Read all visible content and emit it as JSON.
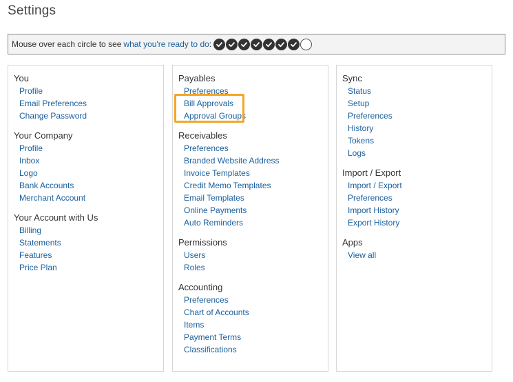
{
  "page": {
    "title": "Settings"
  },
  "progress": {
    "text_prefix": "Mouse over each circle to see",
    "link_text": "what you're ready to do",
    "text_suffix": ":",
    "steps": [
      {
        "done": true
      },
      {
        "done": true
      },
      {
        "done": true
      },
      {
        "done": true
      },
      {
        "done": true
      },
      {
        "done": true
      },
      {
        "done": true
      },
      {
        "done": false
      }
    ]
  },
  "columns": [
    {
      "sections": [
        {
          "heading": "You",
          "links": [
            "Profile",
            "Email Preferences",
            "Change Password"
          ]
        },
        {
          "heading": "Your Company",
          "links": [
            "Profile",
            "Inbox",
            "Logo",
            "Bank Accounts",
            "Merchant Account"
          ]
        },
        {
          "heading": "Your Account with Us",
          "links": [
            "Billing",
            "Statements",
            "Features",
            "Price Plan"
          ]
        }
      ]
    },
    {
      "sections": [
        {
          "heading": "Payables",
          "links": [
            "Preferences",
            "Bill Approvals",
            "Approval Groups"
          ]
        },
        {
          "heading": "Receivables",
          "links": [
            "Preferences",
            "Branded Website Address",
            "Invoice Templates",
            "Credit Memo Templates",
            "Email Templates",
            "Online Payments",
            "Auto Reminders"
          ]
        },
        {
          "heading": "Permissions",
          "links": [
            "Users",
            "Roles"
          ]
        },
        {
          "heading": "Accounting",
          "links": [
            "Preferences",
            "Chart of Accounts",
            "Items",
            "Payment Terms",
            "Classifications"
          ]
        }
      ]
    },
    {
      "sections": [
        {
          "heading": "Sync",
          "links": [
            "Status",
            "Setup",
            "Preferences",
            "History",
            "Tokens",
            "Logs"
          ]
        },
        {
          "heading": "Import / Export",
          "links": [
            "Import / Export",
            "Preferences",
            "Import History",
            "Export History"
          ]
        },
        {
          "heading": "Apps",
          "links": [
            "View all"
          ]
        }
      ]
    }
  ],
  "colors": {
    "link": "#1a5f9e",
    "highlight": "#f5a623"
  }
}
